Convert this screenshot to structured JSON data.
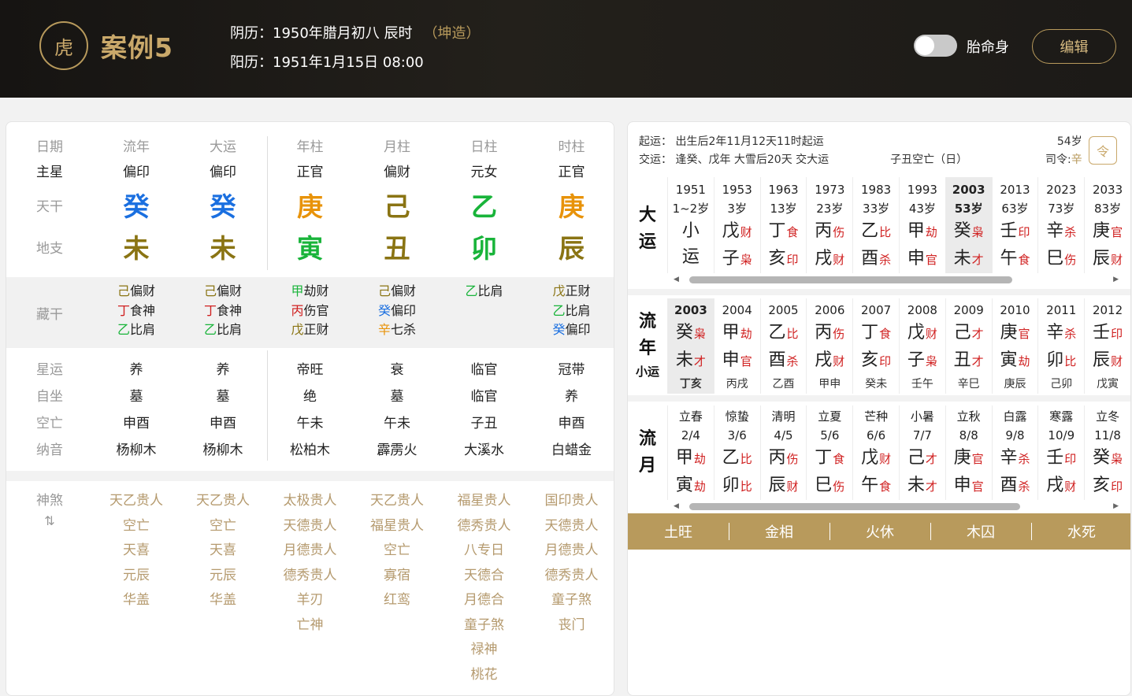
{
  "header": {
    "case_title": "案例5",
    "lunar": "阴历：1950年腊月初八 辰时",
    "gender": "（坤造）",
    "solar": "阳历：1951年1月15日 08:00",
    "toggle_label": "胎命身",
    "edit_label": "编辑",
    "logo_glyph": "虎"
  },
  "left": {
    "columns": [
      "日期",
      "流年",
      "大运",
      "年柱",
      "月柱",
      "日柱",
      "时柱"
    ],
    "stars": [
      "主星",
      "偏印",
      "偏印",
      "正官",
      "偏财",
      "元女",
      "正官"
    ],
    "stems_label": "天干",
    "stems": [
      {
        "t": "癸",
        "c": "#1a6fe0"
      },
      {
        "t": "癸",
        "c": "#1a6fe0"
      },
      {
        "t": "庚",
        "c": "#e8930a"
      },
      {
        "t": "己",
        "c": "#8a7413"
      },
      {
        "t": "乙",
        "c": "#19b43a"
      },
      {
        "t": "庚",
        "c": "#e8930a"
      }
    ],
    "branches_label": "地支",
    "branches": [
      {
        "t": "未",
        "c": "#8a7413"
      },
      {
        "t": "未",
        "c": "#8a7413"
      },
      {
        "t": "寅",
        "c": "#19b43a"
      },
      {
        "t": "丑",
        "c": "#8a7413"
      },
      {
        "t": "卯",
        "c": "#19b43a"
      },
      {
        "t": "辰",
        "c": "#8a7413"
      }
    ],
    "hidden_label": "藏干",
    "hidden": [
      [
        {
          "g": "己",
          "c": "#8a7413",
          "s": "偏财"
        },
        {
          "g": "丁",
          "c": "#d02020",
          "s": "食神"
        },
        {
          "g": "乙",
          "c": "#19b43a",
          "s": "比肩"
        }
      ],
      [
        {
          "g": "己",
          "c": "#8a7413",
          "s": "偏财"
        },
        {
          "g": "丁",
          "c": "#d02020",
          "s": "食神"
        },
        {
          "g": "乙",
          "c": "#19b43a",
          "s": "比肩"
        }
      ],
      [
        {
          "g": "甲",
          "c": "#19b43a",
          "s": "劫财"
        },
        {
          "g": "丙",
          "c": "#d02020",
          "s": "伤官"
        },
        {
          "g": "戊",
          "c": "#8a7413",
          "s": "正财"
        }
      ],
      [
        {
          "g": "己",
          "c": "#8a7413",
          "s": "偏财"
        },
        {
          "g": "癸",
          "c": "#1a6fe0",
          "s": "偏印"
        },
        {
          "g": "辛",
          "c": "#e8930a",
          "s": "七杀"
        }
      ],
      [
        {
          "g": "乙",
          "c": "#19b43a",
          "s": "比肩"
        }
      ],
      [
        {
          "g": "戊",
          "c": "#8a7413",
          "s": "正财"
        },
        {
          "g": "乙",
          "c": "#19b43a",
          "s": "比肩"
        },
        {
          "g": "癸",
          "c": "#1a6fe0",
          "s": "偏印"
        }
      ]
    ],
    "stats": [
      {
        "label": "星运",
        "values": [
          "养",
          "养",
          "帝旺",
          "衰",
          "临官",
          "冠带"
        ]
      },
      {
        "label": "自坐",
        "values": [
          "墓",
          "墓",
          "绝",
          "墓",
          "临官",
          "养"
        ]
      },
      {
        "label": "空亡",
        "values": [
          "申酉",
          "申酉",
          "午未",
          "午未",
          "子丑",
          "申酉"
        ]
      },
      {
        "label": "纳音",
        "values": [
          "杨柳木",
          "杨柳木",
          "松柏木",
          "霹雳火",
          "大溪水",
          "白蜡金"
        ]
      }
    ],
    "shensha_label": "神煞",
    "shensha_toggle": "⇅",
    "shensha": [
      [
        "天乙贵人",
        "空亡",
        "天喜",
        "元辰",
        "华盖"
      ],
      [
        "天乙贵人",
        "空亡",
        "天喜",
        "元辰",
        "华盖"
      ],
      [
        "太极贵人",
        "天德贵人",
        "月德贵人",
        "德秀贵人",
        "羊刃",
        "亡神"
      ],
      [
        "天乙贵人",
        "福星贵人",
        "空亡",
        "寡宿",
        "红鸾"
      ],
      [
        "福星贵人",
        "德秀贵人",
        "八专日",
        "天德合",
        "月德合",
        "童子煞",
        "禄神",
        "桃花"
      ],
      [
        "国印贵人",
        "天德贵人",
        "月德贵人",
        "德秀贵人",
        "童子煞",
        "丧门"
      ]
    ]
  },
  "right": {
    "qiyun": "起运：  出生后2年11月12天11时起运",
    "jiaoyun": "交运：  逢癸、戊年 大雪后20天 交大运",
    "kongwang": "子丑空亡（日）",
    "age": "54岁",
    "siling_label": "司令:",
    "siling": "辛",
    "icon_glyph": "令",
    "dayun_label": [
      "大",
      "运"
    ],
    "dayun": [
      {
        "y": "1951",
        "a": "1~2岁",
        "g1": "小",
        "t1": "",
        "g2": "运",
        "t2": ""
      },
      {
        "y": "1953",
        "a": "3岁",
        "g1": "戊",
        "t1": "财",
        "g2": "子",
        "t2": "枭"
      },
      {
        "y": "1963",
        "a": "13岁",
        "g1": "丁",
        "t1": "食",
        "g2": "亥",
        "t2": "印"
      },
      {
        "y": "1973",
        "a": "23岁",
        "g1": "丙",
        "t1": "伤",
        "g2": "戌",
        "t2": "财"
      },
      {
        "y": "1983",
        "a": "33岁",
        "g1": "乙",
        "t1": "比",
        "g2": "酉",
        "t2": "杀"
      },
      {
        "y": "1993",
        "a": "43岁",
        "g1": "甲",
        "t1": "劫",
        "g2": "申",
        "t2": "官"
      },
      {
        "y": "2003",
        "a": "53岁",
        "g1": "癸",
        "t1": "枭",
        "g2": "未",
        "t2": "才"
      },
      {
        "y": "2013",
        "a": "63岁",
        "g1": "壬",
        "t1": "印",
        "g2": "午",
        "t2": "食"
      },
      {
        "y": "2023",
        "a": "73岁",
        "g1": "辛",
        "t1": "杀",
        "g2": "巳",
        "t2": "伤"
      },
      {
        "y": "2033",
        "a": "83岁",
        "g1": "庚",
        "t1": "官",
        "g2": "辰",
        "t2": "财"
      }
    ],
    "liunian_label": [
      "流",
      "年"
    ],
    "xiaoyun_label": "小运",
    "liunian": [
      {
        "y": "2003",
        "g1": "癸",
        "t1": "枭",
        "g2": "未",
        "t2": "才",
        "x": "丁亥"
      },
      {
        "y": "2004",
        "g1": "甲",
        "t1": "劫",
        "g2": "申",
        "t2": "官",
        "x": "丙戌"
      },
      {
        "y": "2005",
        "g1": "乙",
        "t1": "比",
        "g2": "酉",
        "t2": "杀",
        "x": "乙酉"
      },
      {
        "y": "2006",
        "g1": "丙",
        "t1": "伤",
        "g2": "戌",
        "t2": "财",
        "x": "甲申"
      },
      {
        "y": "2007",
        "g1": "丁",
        "t1": "食",
        "g2": "亥",
        "t2": "印",
        "x": "癸未"
      },
      {
        "y": "2008",
        "g1": "戊",
        "t1": "财",
        "g2": "子",
        "t2": "枭",
        "x": "壬午"
      },
      {
        "y": "2009",
        "g1": "己",
        "t1": "才",
        "g2": "丑",
        "t2": "才",
        "x": "辛巳"
      },
      {
        "y": "2010",
        "g1": "庚",
        "t1": "官",
        "g2": "寅",
        "t2": "劫",
        "x": "庚辰"
      },
      {
        "y": "2011",
        "g1": "辛",
        "t1": "杀",
        "g2": "卯",
        "t2": "比",
        "x": "己卯"
      },
      {
        "y": "2012",
        "g1": "壬",
        "t1": "印",
        "g2": "辰",
        "t2": "财",
        "x": "戊寅"
      }
    ],
    "liuyue_label": [
      "流",
      "月"
    ],
    "liuyue": [
      {
        "n": "立春",
        "d": "2/4",
        "g1": "甲",
        "t1": "劫",
        "g2": "寅",
        "t2": "劫"
      },
      {
        "n": "惊蛰",
        "d": "3/6",
        "g1": "乙",
        "t1": "比",
        "g2": "卯",
        "t2": "比"
      },
      {
        "n": "清明",
        "d": "4/5",
        "g1": "丙",
        "t1": "伤",
        "g2": "辰",
        "t2": "财"
      },
      {
        "n": "立夏",
        "d": "5/6",
        "g1": "丁",
        "t1": "食",
        "g2": "巳",
        "t2": "伤"
      },
      {
        "n": "芒种",
        "d": "6/6",
        "g1": "戊",
        "t1": "财",
        "g2": "午",
        "t2": "食"
      },
      {
        "n": "小暑",
        "d": "7/7",
        "g1": "己",
        "t1": "才",
        "g2": "未",
        "t2": "才"
      },
      {
        "n": "立秋",
        "d": "8/8",
        "g1": "庚",
        "t1": "官",
        "g2": "申",
        "t2": "官"
      },
      {
        "n": "白露",
        "d": "9/8",
        "g1": "辛",
        "t1": "杀",
        "g2": "酉",
        "t2": "杀"
      },
      {
        "n": "寒露",
        "d": "10/9",
        "g1": "壬",
        "t1": "印",
        "g2": "戌",
        "t2": "财"
      },
      {
        "n": "立冬",
        "d": "11/8",
        "g1": "癸",
        "t1": "枭",
        "g2": "亥",
        "t2": "印"
      }
    ],
    "wuxing": [
      "土旺",
      "金相",
      "火休",
      "木囚",
      "水死"
    ]
  },
  "colors": {
    "gold": "#b89a5c",
    "ten_god_red": "#d02020",
    "header_bg": "#1c1a17"
  }
}
